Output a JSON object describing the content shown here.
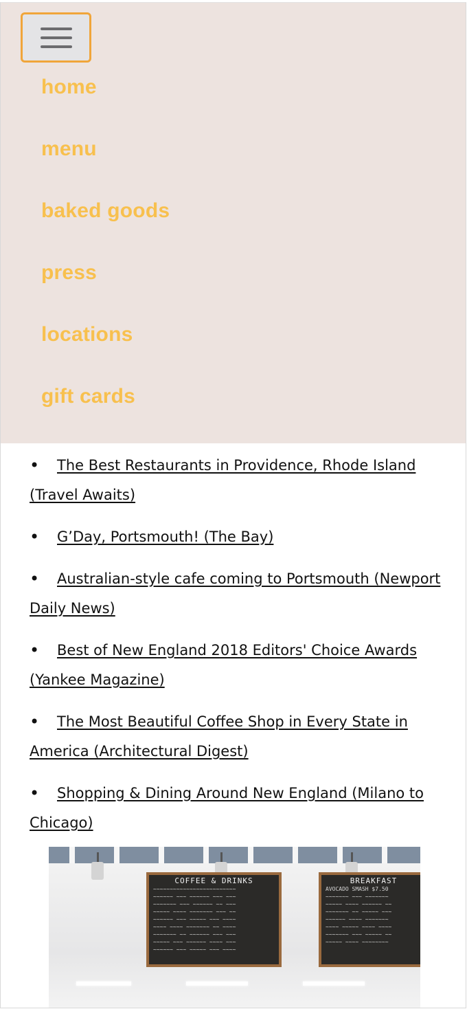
{
  "nav": {
    "items": [
      {
        "label": "home"
      },
      {
        "label": "menu"
      },
      {
        "label": "baked goods"
      },
      {
        "label": "press"
      },
      {
        "label": "locations"
      },
      {
        "label": "gift cards"
      }
    ]
  },
  "press": {
    "items": [
      {
        "first": "The Best Restaurants in Providence, Rhode Island",
        "rest": "(Travel Awaits)"
      },
      {
        "first": "G’Day, Portsmouth! (The Bay)",
        "rest": ""
      },
      {
        "first": "Australian-style cafe coming to Portsmouth (Newport",
        "rest": "Daily News)"
      },
      {
        "first": "Best of New England 2018 Editors' Choice Awards",
        "rest": "(Yankee Magazine)"
      },
      {
        "first": "The Most Beautiful Coffee Shop in Every State in",
        "rest": "America (Architectural Digest)"
      },
      {
        "first": "Shopping & Dining Around New England (Milano to",
        "rest": "Chicago)"
      }
    ]
  },
  "photo": {
    "board_left_title": "COFFEE & DRINKS",
    "board_right_title": "BREAKFAST",
    "board_right_sub": "AVOCADO SMASH $7.50"
  },
  "colors": {
    "nav_bg": "#ede3df",
    "nav_text": "#f8c04e",
    "hamburger_border": "#f0a53a"
  },
  "icons": {
    "menu_toggle": "hamburger-icon"
  }
}
